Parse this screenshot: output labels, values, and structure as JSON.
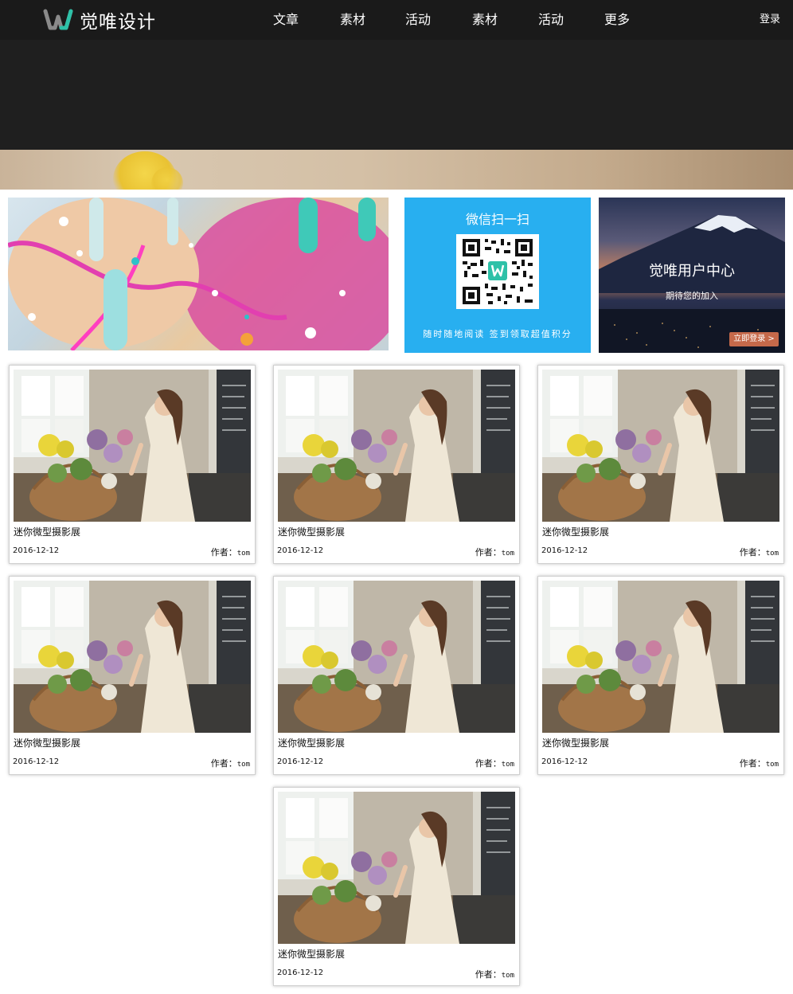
{
  "brand": {
    "name": "觉唯设计",
    "accent": "#2ec1a8"
  },
  "nav": {
    "items": [
      "文章",
      "素材",
      "活动",
      "素材",
      "活动",
      "更多"
    ],
    "login": "登录"
  },
  "qr_panel": {
    "title": "微信扫一扫",
    "caption": "随时随地阅读  签到领取超值积分",
    "bg": "#28aff0"
  },
  "user_panel": {
    "title": "觉唯用户中心",
    "subtitle": "期待您的加入",
    "button": "立即登录 >"
  },
  "cards": [
    {
      "title": "迷你微型摄影展",
      "date": "2016-12-12",
      "author_label": "作者：",
      "author": "tom"
    },
    {
      "title": "迷你微型摄影展",
      "date": "2016-12-12",
      "author_label": "作者：",
      "author": "tom"
    },
    {
      "title": "迷你微型摄影展",
      "date": "2016-12-12",
      "author_label": "作者：",
      "author": "tom"
    },
    {
      "title": "迷你微型摄影展",
      "date": "2016-12-12",
      "author_label": "作者：",
      "author": "tom"
    },
    {
      "title": "迷你微型摄影展",
      "date": "2016-12-12",
      "author_label": "作者：",
      "author": "tom"
    },
    {
      "title": "迷你微型摄影展",
      "date": "2016-12-12",
      "author_label": "作者：",
      "author": "tom"
    },
    {
      "title": "迷你微型摄影展",
      "date": "2016-12-12",
      "author_label": "作者：",
      "author": "tom"
    }
  ]
}
